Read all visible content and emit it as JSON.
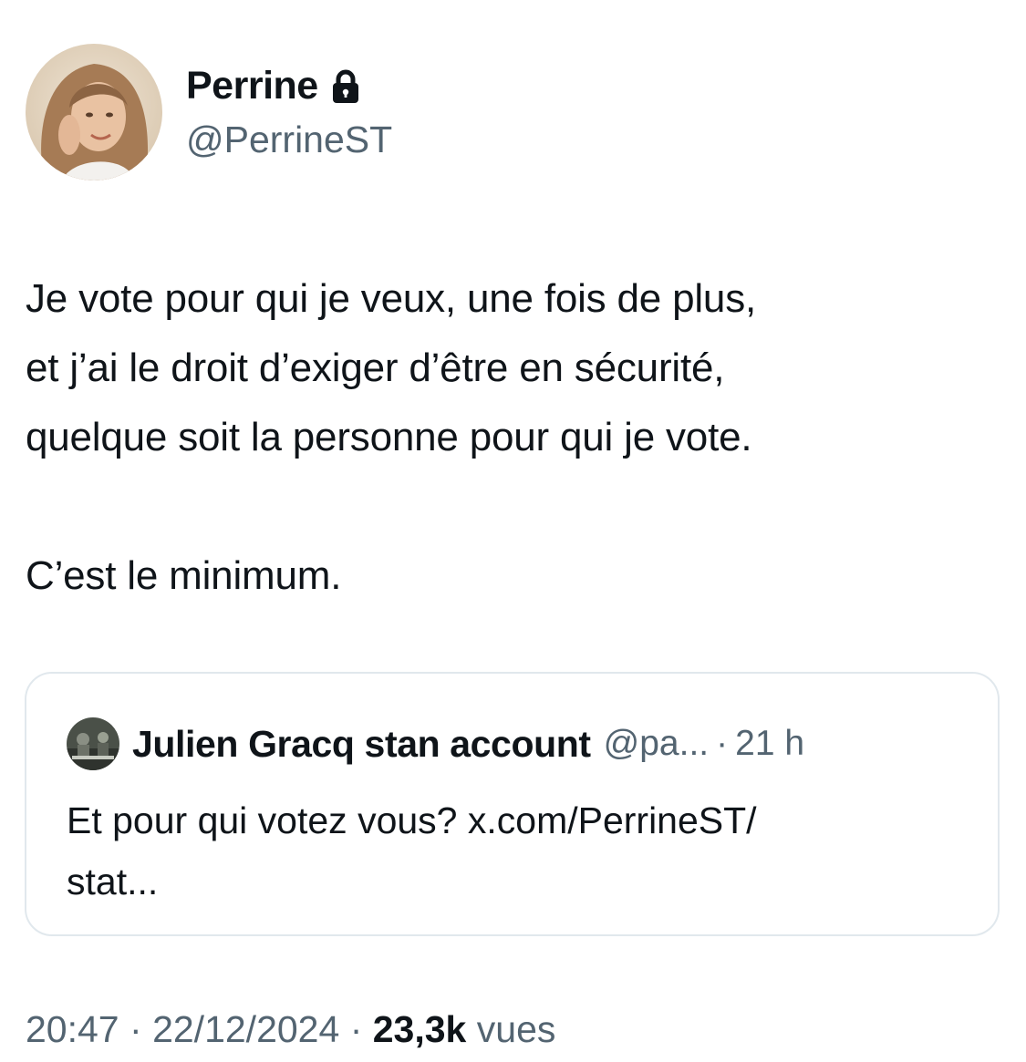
{
  "author": {
    "name": "Perrine",
    "handle": "@PerrineST",
    "avatar_icon": "profile-photo",
    "protected_icon": "lock-icon"
  },
  "tweet": {
    "lines": [
      "Je vote pour qui je veux, une fois de plus,",
      "et j’ai le droit d’exiger d’être en sécurité,",
      "quelque soit la personne pour qui je vote.",
      "C’est le minimum."
    ]
  },
  "quote": {
    "name": "Julien Gracq stan account",
    "handle": "@pa...",
    "separator": "·",
    "time": "21 h",
    "lines": [
      "Et pour qui votez vous? x.com/PerrineST/",
      "stat..."
    ]
  },
  "meta": {
    "time": "20:47",
    "separator_1": "·",
    "date": "22/12/2024",
    "separator_2": "·",
    "views_count": "23,3k",
    "views_label": "vues"
  },
  "colors": {
    "text": "#0f1419",
    "secondary": "#536471",
    "border": "#e1e8ed"
  }
}
